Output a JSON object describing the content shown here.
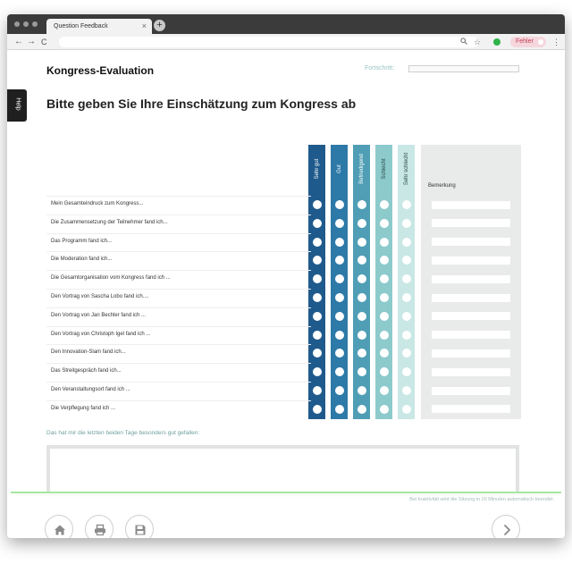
{
  "browser": {
    "tab_title": "Question Feedback",
    "tab_close": "×",
    "new_tab": "+",
    "back": "←",
    "forward": "→",
    "reload": "C",
    "zoom_icon": "zoom-icon",
    "star_icon": "star-icon",
    "error_badge": "Fehler",
    "menu": "⋮"
  },
  "help_tab": "Help",
  "page": {
    "title": "Kongress-Evaluation",
    "progress_label": "Fortschritt:",
    "heading": "Bitte geben Sie Ihre Einschätzung zum Kongress ab"
  },
  "scale": {
    "columns": [
      {
        "label": "Sehr gut",
        "color": "#1f5a8c"
      },
      {
        "label": "Gut",
        "color": "#2d79a8"
      },
      {
        "label": "Befriedigend",
        "color": "#4f9eb5"
      },
      {
        "label": "Schlecht",
        "color": "#8ccacc"
      },
      {
        "label": "Sehr schlecht",
        "color": "#c8e7e5"
      }
    ],
    "remark_label": "Bemerkung"
  },
  "questions": [
    "Mein Gesamteindruck zum Kongress...",
    "Die Zusammensetzung der Teilnehmer fand ich...",
    "Das Programm fand ich...",
    "Die Moderation fand ich...",
    "Die Gesamtorganisation vom Kongress fand ich ...",
    "Den Vortrag von Sascha Lobo fand ich....",
    "Den Vortrag von Jan Bechler fand ich ...",
    "Den Vortrag von Christoph Igel fand ich ...",
    "Den Innovation-Slam fand ich...",
    "Das Streitgespräch fand ich...",
    "Den Veranstaltungsort fand ich ...",
    "Die Verpflegung fand ich ..."
  ],
  "comment": {
    "label": "Das hat mir die letzten beiden Tage besonders gut gefallen:",
    "value": ""
  },
  "footer": {
    "note": "Bei Inaktivität wird die Sitzung in 20 Minuten automatisch beendet.",
    "buttons": [
      "home-icon",
      "print-icon",
      "save-icon",
      "chevron-right-icon"
    ]
  },
  "colors": {
    "accent_green": "#a8e6a0",
    "label_teal": "#6e9f9f"
  }
}
